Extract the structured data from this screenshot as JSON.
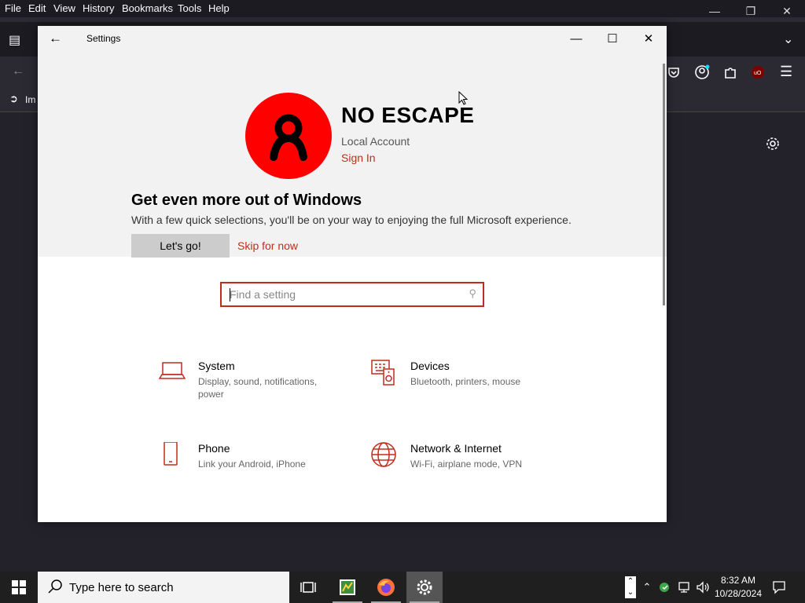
{
  "firefox": {
    "menu": [
      {
        "label": "File"
      },
      {
        "label": "Edit"
      },
      {
        "label": "View"
      },
      {
        "label": "History"
      },
      {
        "label": "Bookmarks"
      },
      {
        "label": "Tools"
      },
      {
        "label": "Help"
      }
    ],
    "bookmark_partial": "Im"
  },
  "settings": {
    "window_title": "Settings",
    "user": {
      "name": "NO ESCAPE",
      "account_type": "Local Account",
      "sign_in_label": "Sign In"
    },
    "promo": {
      "title": "Get even more out of Windows",
      "text": "With a few quick selections, you'll be on your way to enjoying the full Microsoft experience.",
      "primary_button": "Let's go!",
      "secondary_link": "Skip for now"
    },
    "search": {
      "placeholder": "Find a setting"
    },
    "categories": [
      {
        "title": "System",
        "subtitle": "Display, sound, notifications, power",
        "icon": "laptop-icon"
      },
      {
        "title": "Devices",
        "subtitle": "Bluetooth, printers, mouse",
        "icon": "devices-icon"
      },
      {
        "title": "Phone",
        "subtitle": "Link your Android, iPhone",
        "icon": "phone-icon"
      },
      {
        "title": "Network & Internet",
        "subtitle": "Wi-Fi, airplane mode, VPN",
        "icon": "globe-icon"
      }
    ],
    "accent_color": "#c42b1c",
    "avatar_color": "#ff0000"
  },
  "taskbar": {
    "search_placeholder": "Type here to search",
    "clock_time": "8:32 AM",
    "clock_date": "10/28/2024"
  }
}
